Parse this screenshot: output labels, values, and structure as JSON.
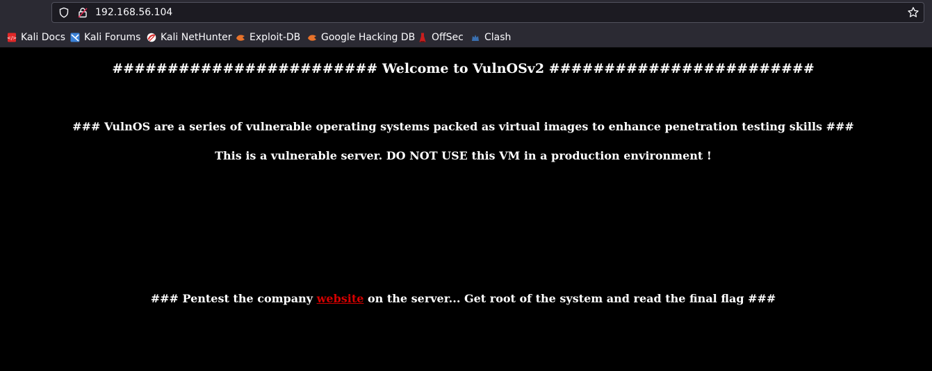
{
  "browser": {
    "url": "192.168.56.104",
    "icons": {
      "tracking": "shield-icon",
      "security": "insecure-lock-icon",
      "bookmark": "star-icon"
    }
  },
  "bookmarks": [
    {
      "label": "Kali Docs",
      "icon": "kali-docs-icon",
      "color": "#e02828"
    },
    {
      "label": "Kali Forums",
      "icon": "kali-forums-icon",
      "color": "#3b82d8"
    },
    {
      "label": "Kali NetHunter",
      "icon": "kali-nethunter-icon",
      "color": "#d93030"
    },
    {
      "label": "Exploit-DB",
      "icon": "exploit-db-icon",
      "color": "#e8722a"
    },
    {
      "label": "Google Hacking DB",
      "icon": "ghdb-icon",
      "color": "#e8722a"
    },
    {
      "label": "OffSec",
      "icon": "offsec-icon",
      "color": "#c81e1e"
    },
    {
      "label": "Clash",
      "icon": "clash-icon",
      "color": "#3a6fb0"
    }
  ],
  "page": {
    "title": "######################## Welcome to VulnOSv2 ########################",
    "description": "### VulnOS are a series of vulnerable operating systems packed as virtual images to enhance penetration testing skills ###",
    "warning": "This is a vulnerable server. DO NOT USE this VM in a production environment !",
    "pentest_prefix": "### Pentest the company ",
    "pentest_link": "website",
    "pentest_suffix": " on the server... Get root of the system and read the final flag ###",
    "link_color": "#d40000"
  }
}
